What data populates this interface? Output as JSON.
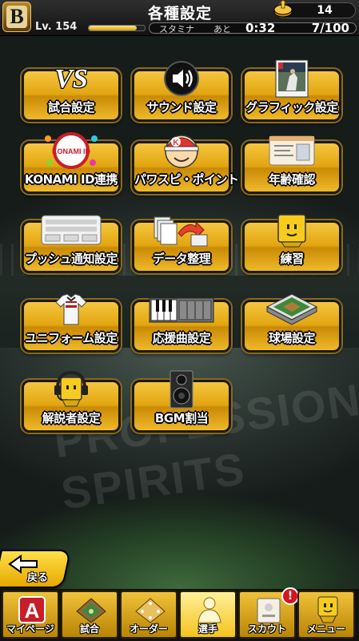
{
  "header": {
    "title": "各種設定",
    "team_logo_letter": "B",
    "level": "Lv. 154",
    "level_progress": 0.85,
    "coins": "14",
    "stamina_label": "スタミナ",
    "ato_label": "あと",
    "timer": "0:32",
    "stamina": "7/100"
  },
  "background": {
    "ghost_text": "PROFESSIONAL SPIRITS"
  },
  "tiles": [
    {
      "label": "試合設定",
      "icon": "vs-icon"
    },
    {
      "label": "サウンド設定",
      "icon": "speaker-icon"
    },
    {
      "label": "グラフィック設定",
      "icon": "photo-icon"
    },
    {
      "label": "KONAMI ID連携",
      "icon": "konami-id-icon",
      "icon_text": "KONAMI ID"
    },
    {
      "label": "パワスピ・ポイント",
      "icon": "power-spi-face-icon",
      "icon_text": "K"
    },
    {
      "label": "年齢確認",
      "icon": "id-card-icon"
    },
    {
      "label": "プッシュ通知設定",
      "icon": "notification-panel-icon"
    },
    {
      "label": "データ整理",
      "icon": "data-transfer-icon"
    },
    {
      "label": "練習",
      "icon": "practice-face-icon"
    },
    {
      "label": "ユニフォーム設定",
      "icon": "uniform-icon"
    },
    {
      "label": "応援曲設定",
      "icon": "piano-keys-icon"
    },
    {
      "label": "球場設定",
      "icon": "stadium-icon"
    },
    {
      "label": "解説者設定",
      "icon": "commentator-headset-icon"
    },
    {
      "label": "BGM割当",
      "icon": "bgm-speaker-icon"
    }
  ],
  "back_button": {
    "label": "戻る"
  },
  "nav": [
    {
      "label": "マイページ",
      "icon": "mypage-a-icon",
      "icon_text": "A"
    },
    {
      "label": "試合",
      "icon": "baseball-field-icon"
    },
    {
      "label": "オーダー",
      "icon": "order-field-icon"
    },
    {
      "label": "選手",
      "icon": "player-icon",
      "active": true
    },
    {
      "label": "スカウト",
      "icon": "scout-card-icon",
      "badge": "!"
    },
    {
      "label": "メニュー",
      "icon": "menu-face-icon"
    }
  ],
  "colors": {
    "tile_gold": "#e2a510",
    "badge_red": "#d8141c"
  }
}
